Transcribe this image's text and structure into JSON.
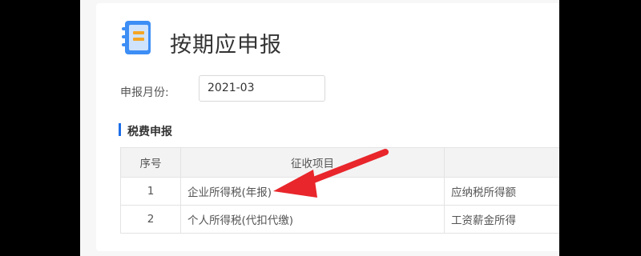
{
  "page": {
    "title": "按期应申报",
    "icon": "notebook-icon"
  },
  "filter": {
    "month_label": "申报月份:",
    "month_value": "2021-03"
  },
  "section": {
    "title": "税费申报"
  },
  "table": {
    "headers": [
      "序号",
      "征收项目",
      ""
    ],
    "rows": [
      {
        "num": "1",
        "item": "企业所得税(年报)",
        "base": "应纳税所得额"
      },
      {
        "num": "2",
        "item": "个人所得税(代扣代缴)",
        "base": "工资薪金所得"
      }
    ]
  },
  "annotation": {
    "arrow_color": "#e8262b",
    "points_to": "企业所得税(年报)"
  }
}
